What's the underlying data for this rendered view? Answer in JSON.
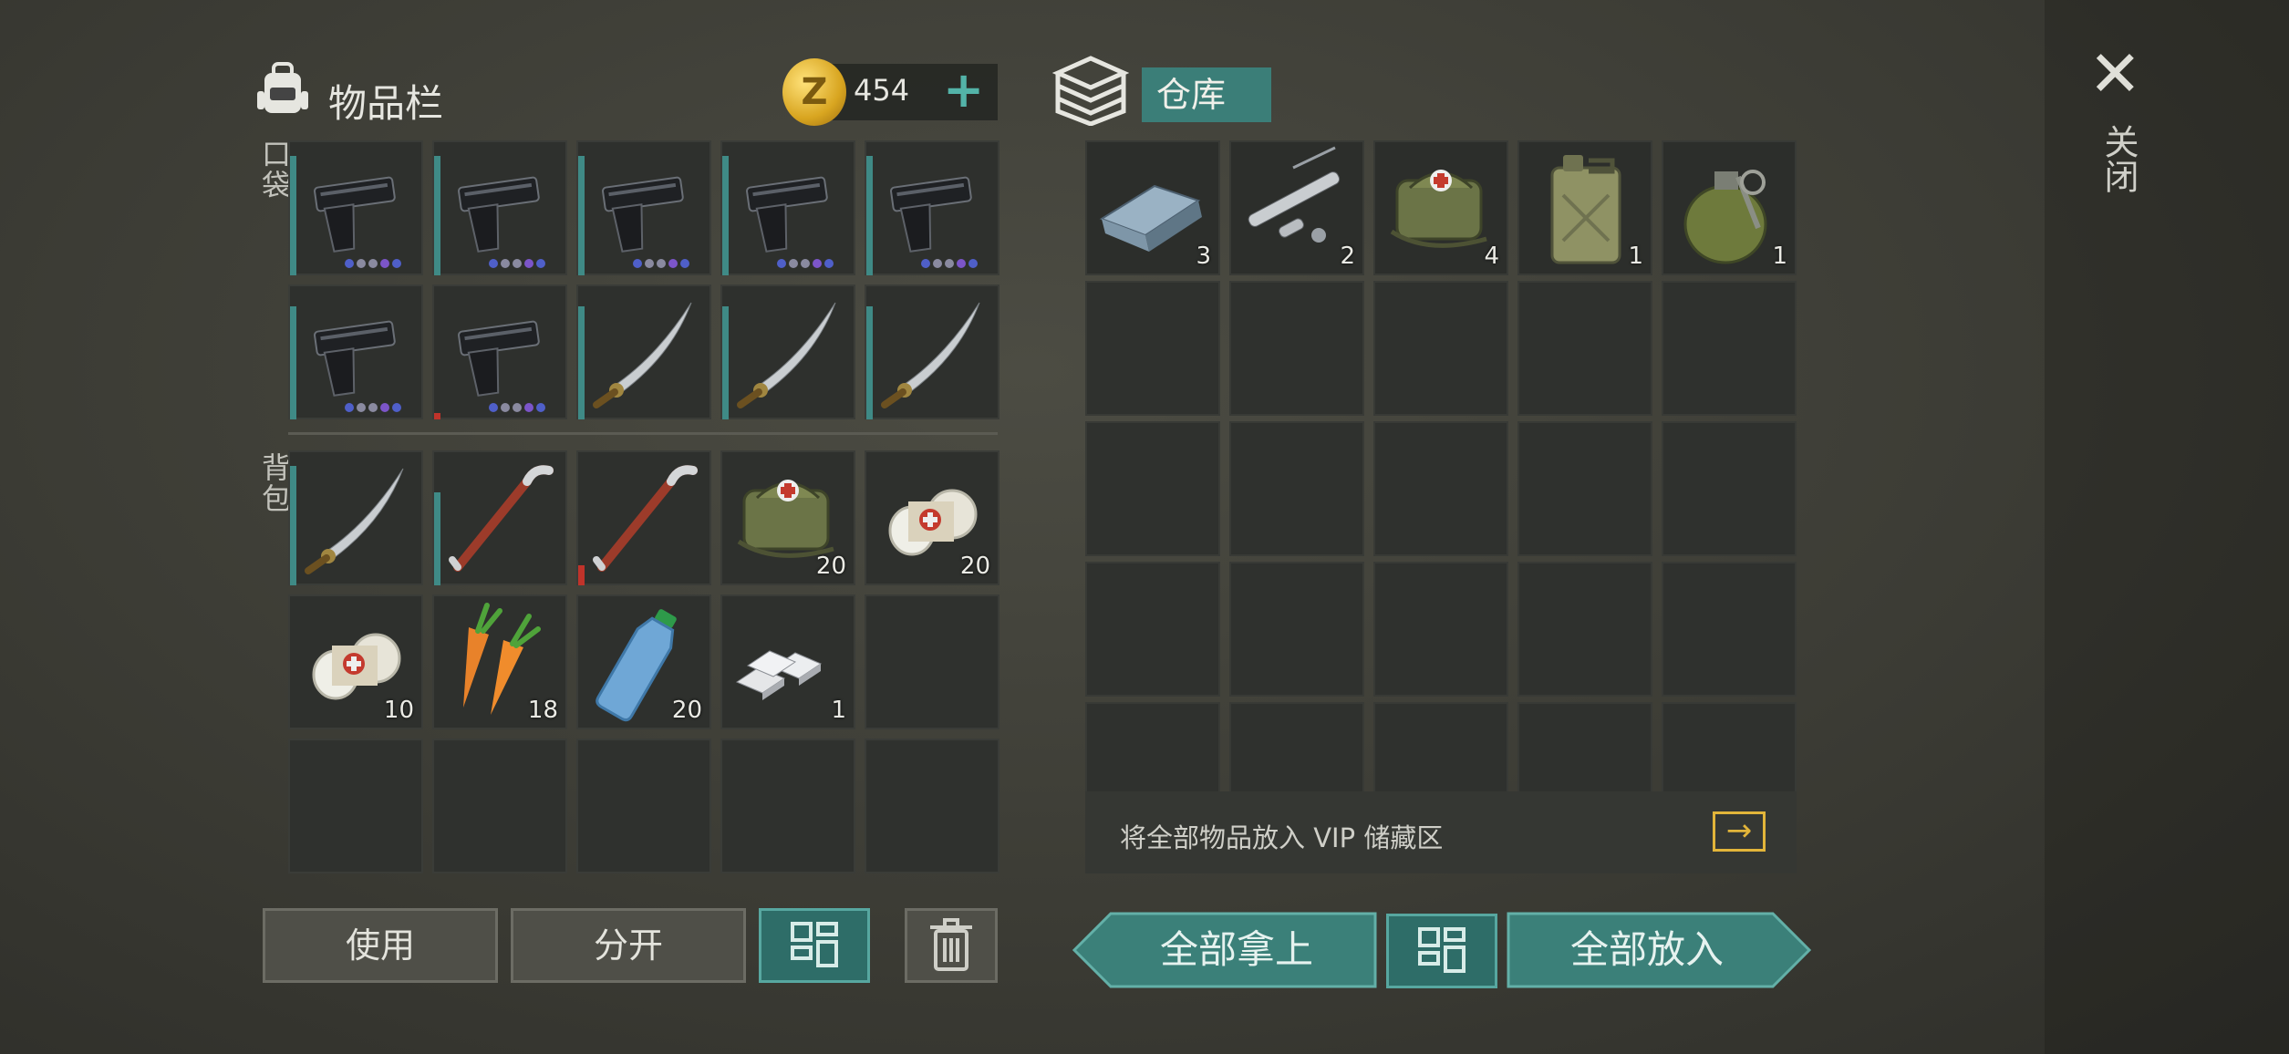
{
  "header": {
    "inventory_title": "物品栏",
    "coin_symbol": "Z",
    "coin_amount": "454",
    "add_label": "+",
    "storage_title": "仓库"
  },
  "labels": {
    "pockets": "口袋",
    "backpack": "背包"
  },
  "pockets": [
    {
      "item": "pistol",
      "durability": 0.9,
      "dots": [
        "#4f5fc9",
        "#8a8aa0",
        "#8a8aa0",
        "#7c55c9",
        "#4f5fc9"
      ]
    },
    {
      "item": "pistol",
      "durability": 0.9,
      "dots": [
        "#4f5fc9",
        "#8a8aa0",
        "#8a8aa0",
        "#7c55c9",
        "#4f5fc9"
      ]
    },
    {
      "item": "pistol",
      "durability": 0.9,
      "dots": [
        "#4f5fc9",
        "#8a8aa0",
        "#8a8aa0",
        "#7c55c9",
        "#4f5fc9"
      ]
    },
    {
      "item": "pistol",
      "durability": 0.9,
      "dots": [
        "#4f5fc9",
        "#8a8aa0",
        "#8a8aa0",
        "#7c55c9",
        "#4f5fc9"
      ]
    },
    {
      "item": "pistol",
      "durability": 0.9,
      "dots": [
        "#4f5fc9",
        "#8a8aa0",
        "#8a8aa0",
        "#7c55c9",
        "#4f5fc9"
      ]
    },
    {
      "item": "pistol",
      "durability": 0.85,
      "dots": [
        "#4f5fc9",
        "#8a8aa0",
        "#8a8aa0",
        "#7c55c9",
        "#4f5fc9"
      ]
    },
    {
      "item": "pistol",
      "durability": 0.05,
      "dur_color": "red",
      "dots": [
        "#4f5fc9",
        "#8a8aa0",
        "#8a8aa0",
        "#7c55c9",
        "#4f5fc9"
      ]
    },
    {
      "item": "katana",
      "durability": 0.85
    },
    {
      "item": "katana",
      "durability": 0.85
    },
    {
      "item": "katana",
      "durability": 0.85
    }
  ],
  "backpack": [
    {
      "item": "katana",
      "durability": 0.9
    },
    {
      "item": "crowbar",
      "durability": 0.7
    },
    {
      "item": "crowbar",
      "durability": 0.15,
      "dur_color": "red"
    },
    {
      "item": "medkit",
      "count": "20"
    },
    {
      "item": "bandage",
      "count": "20"
    },
    {
      "item": "bandage",
      "count": "10"
    },
    {
      "item": "carrot",
      "count": "18"
    },
    {
      "item": "water-bottle",
      "count": "20"
    },
    {
      "item": "silver-bars",
      "count": "1"
    },
    {
      "item": ""
    },
    {
      "item": ""
    },
    {
      "item": ""
    },
    {
      "item": ""
    },
    {
      "item": ""
    },
    {
      "item": ""
    }
  ],
  "storage": [
    {
      "item": "metal-ingot",
      "count": "3"
    },
    {
      "item": "gun-parts",
      "count": "2"
    },
    {
      "item": "medkit",
      "count": "4"
    },
    {
      "item": "jerrycan",
      "count": "1"
    },
    {
      "item": "grenade",
      "count": "1"
    }
  ],
  "vip": {
    "text": "将全部物品放入 VIP 储藏区",
    "arrow": "→"
  },
  "buttons": {
    "use": "使用",
    "split": "分开",
    "take_all": "全部拿上",
    "put_all": "全部放入"
  },
  "close": {
    "x": "✕",
    "label": "关闭"
  },
  "colors": {
    "accent": "#3b7e78",
    "durability": "#3f8a86",
    "durability_low": "#c0332a",
    "vip": "#e2b53a"
  }
}
